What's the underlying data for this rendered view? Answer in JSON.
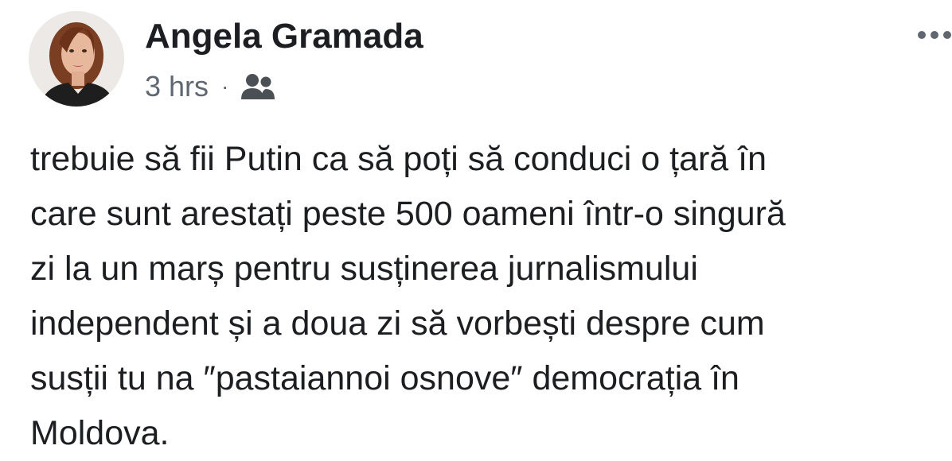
{
  "post": {
    "author_name": "Angela Gramada",
    "timestamp": "3 hrs",
    "separator": "·",
    "audience_icon": "friends-icon",
    "more_icon": "more-options-icon",
    "avatar_icon": "profile-photo",
    "body_lines": [
      "trebuie să fii Putin ca să poți să conduci o țară în",
      "care sunt arestați peste 500 oameni într-o singură",
      "zi la un marș pentru susținerea jurnalismului",
      "independent și a doua zi să vorbești despre cum",
      "susții tu na ″pastaiannoi osnove″ democrația în",
      "Moldova."
    ]
  },
  "colors": {
    "text_primary": "#1c1e21",
    "text_secondary": "#606770",
    "icon_gray": "#4b4f56",
    "background": "#ffffff"
  }
}
